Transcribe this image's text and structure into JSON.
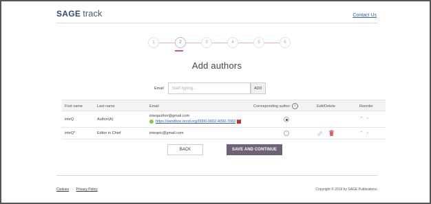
{
  "header": {
    "logo_sage": "SAGE",
    "logo_track": "track",
    "contact_label": "Contact Us"
  },
  "stepper": {
    "steps": [
      "1",
      "2",
      "3",
      "4",
      "5",
      "6"
    ],
    "active_step": 2
  },
  "page_title": "Add authors",
  "email_search": {
    "label": "Email",
    "placeholder": "Start typing...",
    "add_label": "ADD"
  },
  "table": {
    "headers": {
      "first_name": "First name",
      "last_name": "Last name",
      "email": "Email",
      "corresponding": "Corresponding author",
      "edit_delete": "Edit/Delete",
      "reorder": "Reorder"
    },
    "rows": [
      {
        "first_name": "inteQ",
        "last_name": "Author(A)",
        "email": "inteqauthor@gmail.com",
        "orcid": "https://sandbox.orcid.org/0000-0002-4090-7083",
        "corresponding": true
      },
      {
        "first_name": "inteQ*",
        "last_name": "Editor in Chief",
        "email": "inteqeic@gmail.com",
        "corresponding": false
      }
    ]
  },
  "actions": {
    "back_label": "BACK",
    "save_label": "SAVE AND CONTINUE"
  },
  "footer": {
    "cookies_label": "Cookies",
    "separator": "·",
    "privacy_label": "Privacy Policy",
    "copyright": "Copyright © 2019 by SAGE Publications."
  },
  "colors": {
    "accent": "#d9527a",
    "primary_button": "#6e6277",
    "link": "#2a66b0"
  }
}
